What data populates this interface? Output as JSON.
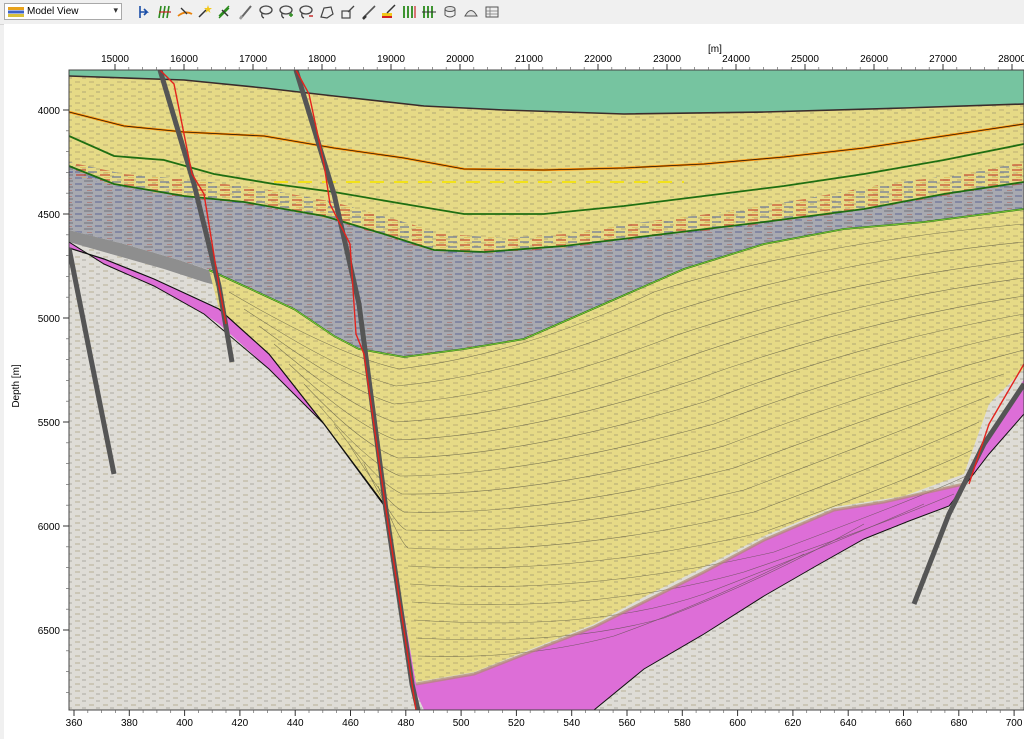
{
  "toolbar": {
    "view_label": "Model View",
    "tools": [
      {
        "name": "select-tool-icon"
      },
      {
        "name": "digitize-faults-icon"
      },
      {
        "name": "edit-horizon-icon"
      },
      {
        "name": "star-tool-icon"
      },
      {
        "name": "pencil-tool-icon"
      },
      {
        "name": "brush-tool-icon"
      },
      {
        "name": "lasso-tool-icon"
      },
      {
        "name": "lasso-add-icon"
      },
      {
        "name": "lasso-remove-icon"
      },
      {
        "name": "polygon-tool-icon"
      },
      {
        "name": "polygon-edit-icon"
      },
      {
        "name": "line-tool-icon"
      },
      {
        "name": "highlight-tool-icon"
      },
      {
        "name": "fault-sticks-icon"
      },
      {
        "name": "fault-sticks-alt-icon"
      },
      {
        "name": "cylinder-icon"
      },
      {
        "name": "dome-icon"
      },
      {
        "name": "settings-grid-icon"
      }
    ]
  },
  "section": {
    "x_unit": "[m]",
    "x_ticks": [
      "15000",
      "16000",
      "17000",
      "18000",
      "19000",
      "20000",
      "21000",
      "22000",
      "23000",
      "24000",
      "25000",
      "26000",
      "27000",
      "28000"
    ],
    "depth_label": "Depth [m]",
    "depth_ticks": [
      "4000",
      "4500",
      "5000",
      "5500",
      "6000",
      "6500"
    ],
    "trace_ticks": [
      "360",
      "380",
      "400",
      "420",
      "440",
      "460",
      "480",
      "500",
      "520",
      "540",
      "560",
      "580",
      "600",
      "620",
      "640",
      "660",
      "680",
      "700"
    ],
    "colors": {
      "water": "#76c4a0",
      "sediment": "#e6da86",
      "basement": "#dedcd6",
      "salt": "#dd6ed7",
      "grey_unit": "#a8a9b0",
      "fault": "#e4231d",
      "horizon_orange": "#ff8c00",
      "horizon_green": "#1f6e12"
    }
  }
}
